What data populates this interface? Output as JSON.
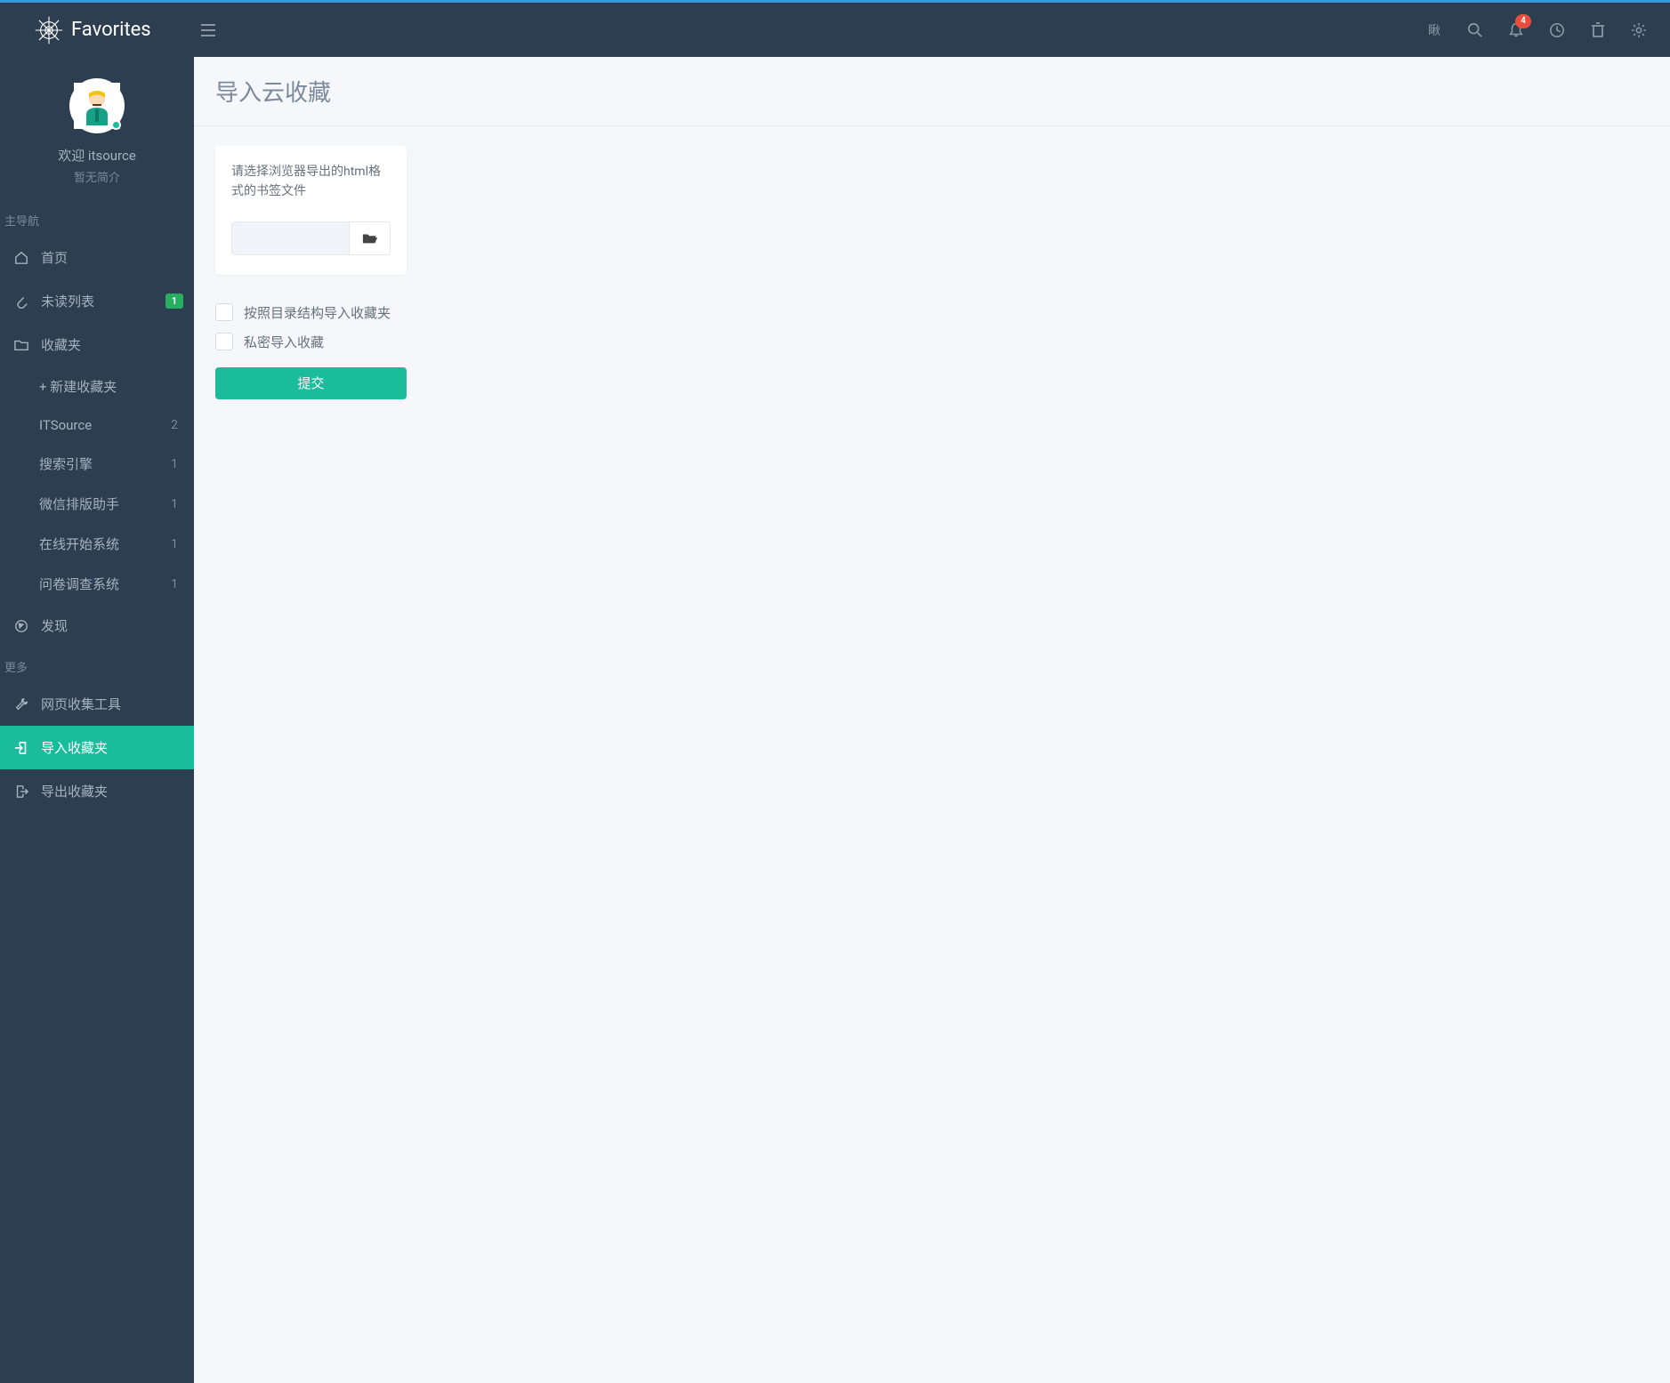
{
  "brand": "Favorites",
  "topbar": {
    "wtf": "瞅",
    "notification_count": "4"
  },
  "profile": {
    "welcome": "欢迎 itsource",
    "bio": "暂无简介"
  },
  "nav": {
    "header_main": "主导航",
    "home": "首页",
    "unread": "未读列表",
    "unread_badge": "1",
    "folders": "收藏夹",
    "new_folder": "+ 新建收藏夹",
    "folder_items": [
      {
        "label": "ITSource",
        "count": "2"
      },
      {
        "label": "搜索引擎",
        "count": "1"
      },
      {
        "label": "微信排版助手",
        "count": "1"
      },
      {
        "label": "在线开始系统",
        "count": "1"
      },
      {
        "label": "问卷调查系统",
        "count": "1"
      }
    ],
    "discover": "发现",
    "header_more": "更多",
    "collect_tool": "网页收集工具",
    "import": "导入收藏夹",
    "export": "导出收藏夹"
  },
  "page": {
    "title": "导入云收藏",
    "card_text": "请选择浏览器导出的html格式的书签文件",
    "checkbox1": "按照目录结构导入收藏夹",
    "checkbox2": "私密导入收藏",
    "submit": "提交"
  }
}
